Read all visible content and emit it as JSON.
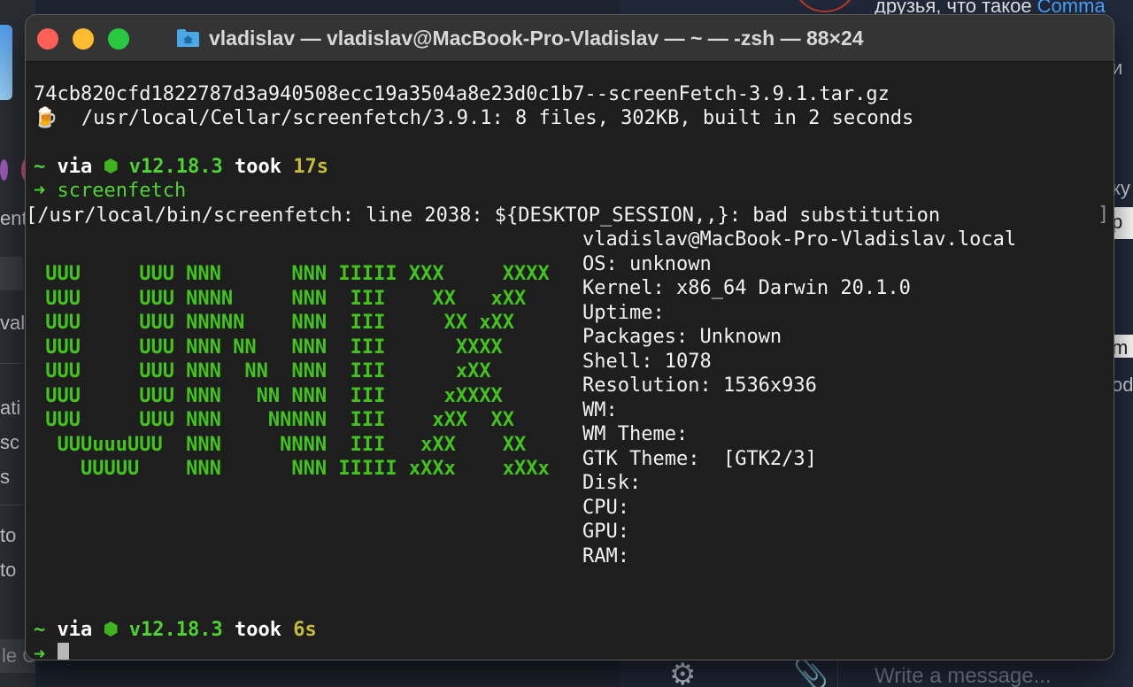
{
  "background": {
    "left_fragments": [
      "ent",
      "val",
      "ati",
      "sc",
      "s",
      "to",
      "to"
    ],
    "left_bottom_chip": "le Chrome",
    "right_top_text_prefix": "друзья, что такое ",
    "right_top_text_highlight": "Comma",
    "right_fragments": [
      "и",
      "ку",
      "р",
      "m",
      "od"
    ],
    "message_placeholder": "Write a message...",
    "icons": [
      "gear-icon",
      "paperclip-icon"
    ]
  },
  "window": {
    "title": "vladislav — vladislav@MacBook-Pro-Vladislav — ~ — -zsh — 88×24",
    "folder_icon": "home-folder-icon"
  },
  "terminal": {
    "line1": "74cb820cfd1822787d3a940508ecc19a3504a8e23d0c1b7--screenFetch-3.9.1.tar.gz",
    "line2_emoji": "🍺",
    "line2_text": "  /usr/local/Cellar/screenfetch/3.9.1: 8 files, 302KB, built in 2 seconds",
    "prompt1": {
      "tilde": "~",
      "via": "via",
      "node_version": "v12.18.3",
      "took": "took",
      "duration": "17s"
    },
    "command": {
      "arrow": "➜",
      "text": "screenfetch"
    },
    "error_line": "[/usr/local/bin/screenfetch: line 2038: ${DESKTOP_SESSION,,}: bad substitution",
    "ascii_art": " UUU     UUU NNN      NNN IIIII XXX     XXXX\n UUU     UUU NNNN     NNN  III    XX   xXX\n UUU     UUU NNNNN    NNN  III     XX xXX\n UUU     UUU NNN NN   NNN  III      XXXX\n UUU     UUU NNN  NN  NNN  III      xXX\n UUU     UUU NNN   NN NNN  III     xXXXX\n UUU     UUU NNN    NNNNN  III    xXX  XX\n  UUUuuuUUU  NNN     NNNN  III   xXX    XX\n    UUUUU    NNN      NNN IIIII xXXx    xXXx",
    "info": {
      "host": "vladislav@MacBook-Pro-Vladislav.local",
      "os_label": "OS:",
      "os_value": " unknown",
      "kernel_label": "Kernel:",
      "kernel_value": " x86_64 Darwin 20.1.0",
      "uptime_label": "Uptime:",
      "uptime_value": "",
      "packages_label": "Packages:",
      "packages_value": " Unknown",
      "shell_label": "Shell:",
      "shell_value": " 1078",
      "resolution_label": "Resolution:",
      "resolution_value": " 1536x936",
      "wm_label": "WM:",
      "wm_value": "",
      "wm_theme_label": "WM Theme:",
      "wm_theme_value": "",
      "gtk_theme_label": "GTK Theme:",
      "gtk_theme_value": "  [GTK2/3]",
      "disk_label": "Disk:",
      "cpu_label": "CPU:",
      "gpu_label": "GPU:",
      "ram_label": "RAM:"
    },
    "right_bracket": "]",
    "prompt2": {
      "tilde": "~",
      "via": "via",
      "node_version": "v12.18.3",
      "took": "took",
      "duration": "6s"
    },
    "prompt2_arrow": "➜"
  },
  "colors": {
    "prompt_green": "#4fd332",
    "duration_yellow": "#c5bd3a",
    "terminal_bg": "#1e1e1e",
    "titlebar_bg": "#343434",
    "close": "#fe5f57",
    "minimize": "#febc2e",
    "maximize": "#28c840"
  }
}
